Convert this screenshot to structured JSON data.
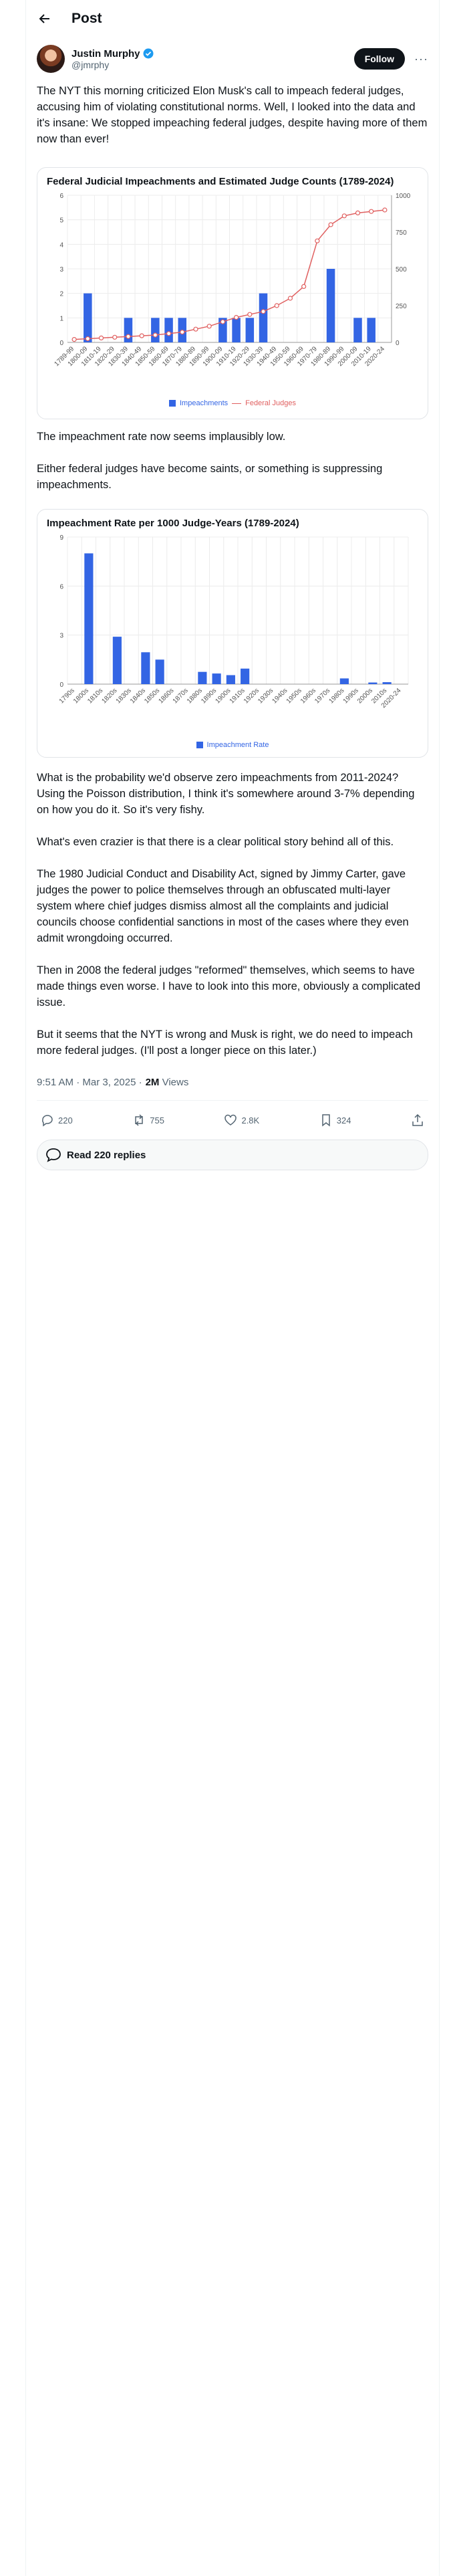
{
  "header": {
    "title": "Post"
  },
  "author": {
    "name": "Justin Murphy",
    "handle": "@jmrphy"
  },
  "follow_label": "Follow",
  "paragraphs": {
    "p1": "The NYT this morning criticized Elon Musk's call to impeach federal judges, accusing him of violating constitutional norms. Well, I looked into the data and it's insane: We stopped impeaching federal judges, despite having more of them now than ever!",
    "p2": "The impeachment rate now seems implausibly low.",
    "p3": "Either federal judges have become saints, or something is suppressing impeachments.",
    "p4": "What is the probability we'd observe zero impeachments from 2011-2024? Using the Poisson distribution, I think it's somewhere around 3-7% depending on how you do it. So it's very fishy.",
    "p5": "What's even crazier is that there is a clear political story behind all of this.",
    "p6": "The 1980 Judicial Conduct and Disability Act, signed by Jimmy Carter, gave judges the power to police themselves through an obfuscated multi-layer system where chief judges dismiss almost all the complaints and judicial councils choose confidential sanctions in most of the cases where they even admit wrongdoing occurred.",
    "p7": "Then in 2008 the federal judges \"reformed\" themselves, which seems to have made things even worse. I have to look into this more, obviously a complicated issue.",
    "p8": "But it seems that the NYT is wrong and Musk is right, we do need to impeach more federal judges. (I'll post a longer piece on this later.)"
  },
  "meta": {
    "time": "9:51 AM · Mar 3, 2025 · ",
    "views_count": "2M",
    "views_label": " Views"
  },
  "actions": {
    "replies": "220",
    "reposts": "755",
    "likes": "2.8K",
    "bookmarks": "324"
  },
  "read_replies": "Read 220 replies",
  "colors": {
    "bar": "#3365e4",
    "line": "#e06060",
    "follow_bg": "#0f1419",
    "verified": "#1d9bf0"
  },
  "icons": [
    "back-arrow-icon",
    "verified-badge-icon",
    "more-icon",
    "reply-icon",
    "repost-icon",
    "like-icon",
    "bookmark-icon",
    "share-icon",
    "speech-bubble-icon"
  ],
  "chart_data": [
    {
      "type": "bar",
      "title": "Federal Judicial Impeachments and Estimated Judge Counts (1789-2024)",
      "categories": [
        "1789-99",
        "1800-09",
        "1810-19",
        "1820-29",
        "1830-39",
        "1840-49",
        "1850-59",
        "1860-69",
        "1870-79",
        "1880-89",
        "1890-99",
        "1900-09",
        "1910-19",
        "1920-29",
        "1930-39",
        "1940-49",
        "1950-59",
        "1960-69",
        "1970-79",
        "1980-89",
        "1990-99",
        "2000-09",
        "2010-19",
        "2020-24"
      ],
      "series": [
        {
          "name": "Impeachments",
          "axis": "left",
          "values": [
            0,
            2,
            0,
            0,
            1,
            0,
            1,
            1,
            1,
            0,
            0,
            1,
            1,
            1,
            2,
            0,
            0,
            0,
            0,
            3,
            0,
            1,
            1,
            0
          ]
        },
        {
          "name": "Federal Judges",
          "axis": "right",
          "type": "line",
          "values": [
            20,
            25,
            30,
            35,
            40,
            45,
            50,
            60,
            70,
            90,
            110,
            140,
            170,
            190,
            210,
            250,
            300,
            380,
            690,
            800,
            860,
            880,
            890,
            900
          ]
        }
      ],
      "ylim_left": [
        0,
        6
      ],
      "ylim_right": [
        0,
        1000
      ],
      "yticks_left": [
        0,
        1,
        2,
        3,
        4,
        5,
        6
      ],
      "yticks_right": [
        0,
        250,
        500,
        750,
        1000
      ],
      "legend": "bottom-center",
      "grid": true
    },
    {
      "type": "bar",
      "title": "Impeachment Rate per 1000 Judge-Years (1789-2024)",
      "categories": [
        "1790s",
        "1800s",
        "1810s",
        "1820s",
        "1830s",
        "1840s",
        "1850s",
        "1860s",
        "1870s",
        "1880s",
        "1890s",
        "1900s",
        "1910s",
        "1920s",
        "1930s",
        "1940s",
        "1950s",
        "1960s",
        "1970s",
        "1980s",
        "1990s",
        "2000s",
        "2010s",
        "2020-24"
      ],
      "series": [
        {
          "name": "Impeachment Rate",
          "values": [
            0,
            8.0,
            0,
            2.9,
            0,
            1.95,
            1.5,
            0,
            0,
            0.75,
            0.65,
            0.55,
            0.95,
            0,
            0,
            0,
            0,
            0,
            0,
            0.35,
            0,
            0.1,
            0.12,
            0
          ]
        }
      ],
      "ylim": [
        0,
        9
      ],
      "yticks": [
        0,
        3,
        6,
        9
      ],
      "legend": "bottom-center",
      "grid": true
    }
  ]
}
